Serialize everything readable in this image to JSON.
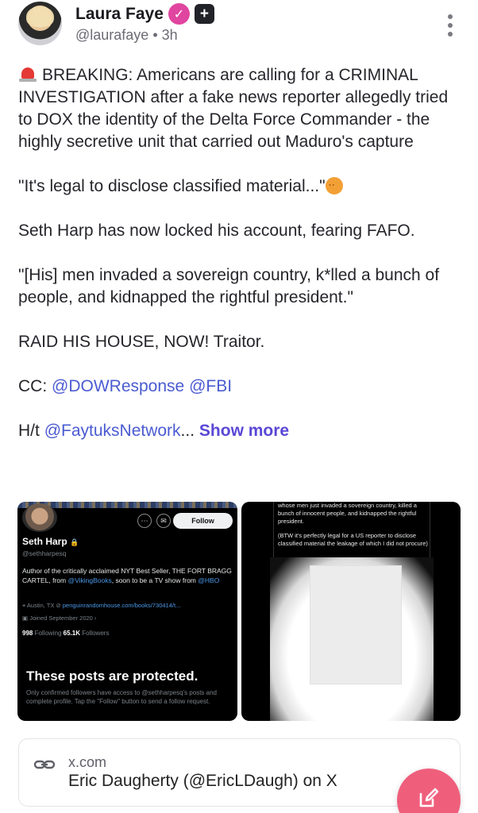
{
  "post": {
    "author_name": "Laura Faye",
    "verified_glyph": "✓",
    "plus_glyph": "+",
    "handle": "@laurafaye",
    "separator": "•",
    "time": "3h",
    "paragraphs": {
      "p1": "BREAKING: Americans are calling for a CRIMINAL INVESTIGATION after a fake news reporter allegedly tried to DOX the identity of the Delta Force Commander - the highly secretive unit that carried out Maduro's capture",
      "p2": "\"It's legal to disclose classified material...\"",
      "p3": "Seth Harp has now locked his account, fearing FAFO.",
      "p4": "\"[His] men invaded a sovereign country, k*lled a bunch of people, and kidnapped the rightful president.\"",
      "p5": "RAID HIS HOUSE, NOW! Traitor.",
      "cc_label": "CC:",
      "cc_link1": "@DOWResponse",
      "cc_link2": "@FBI",
      "ht_label": "H/t",
      "ht_link": "@FaytuksNetwork",
      "ellipsis": "...",
      "show_more": "Show more"
    },
    "icons": {
      "siren": "siren-emoji",
      "angry": "angry-face-emoji",
      "menu": "kebab-menu-icon"
    }
  },
  "media_left": {
    "follow_label": "Follow",
    "name": "Seth Harp",
    "lock_glyph": "🔒",
    "handle": "@sethharpesq",
    "bio_prefix": "Author of the critically acclaimed NYT Best Seller, THE FORT BRAGG CARTEL, from",
    "bio_link1": "@VikingBooks",
    "bio_mid": ", soon to be a TV show from",
    "bio_link2": "@HBO",
    "location": "Austin, TX",
    "website": "penguinrandomhouse.com/books/730414/t...",
    "joined": "Joined September 2020",
    "following_count": "998",
    "following_label": "Following",
    "followers_count": "65.1K",
    "followers_label": "Followers",
    "protected_title": "These posts are protected.",
    "protected_desc": "Only confirmed followers have access to @sethharpesq's posts and complete profile. Tap the \"Follow\" button to send a follow request."
  },
  "media_right": {
    "text1": "whose men just invaded a sovereign country, killed a bunch of innocent people, and kidnapped the rightful president.",
    "text2": "(BTW it's perfectly legal for a US reporter to disclose classified material the leakage of which I did not procure)"
  },
  "link_card": {
    "domain": "x.com",
    "title": "Eric Daugherty (@EricLDaugh) on X"
  },
  "colors": {
    "link": "#4b5bd1",
    "show_more": "#5a48d6",
    "verified": "#e0459f",
    "fab": "#ef5f7c"
  }
}
